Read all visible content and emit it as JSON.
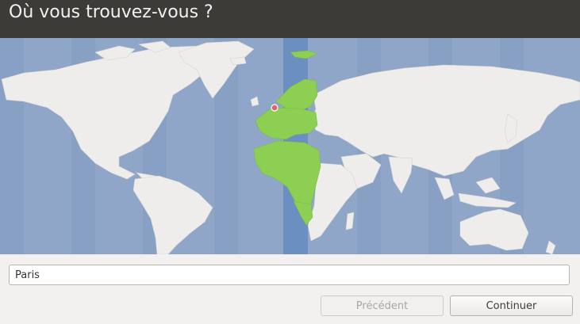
{
  "header": {
    "title": "Où vous trouvez-vous ?"
  },
  "map": {
    "selected_city": "Paris",
    "colors": {
      "ocean": "#8fa6c8",
      "land": "#efedec",
      "timezone_band": "#6c8fc2",
      "selected_land": "#8dcf52",
      "marker": "#e2626a"
    }
  },
  "location": {
    "value": "Paris"
  },
  "buttons": {
    "back_label": "Précédent",
    "continue_label": "Continuer"
  }
}
